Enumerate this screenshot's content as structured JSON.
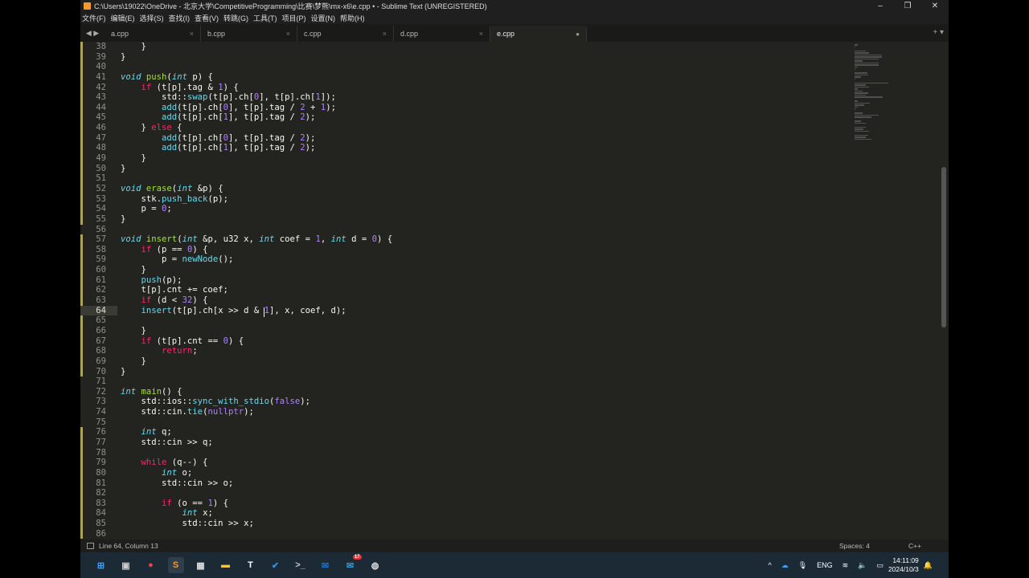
{
  "window": {
    "title": "C:\\Users\\19022\\OneDrive - 北京大学\\CompetitiveProgramming\\比赛\\梦熊\\mx-x6\\e.cpp • - Sublime Text (UNREGISTERED)",
    "minimize": "–",
    "maximize": "❐",
    "close": "✕"
  },
  "menu": [
    "文件(F)",
    "编辑(E)",
    "选择(S)",
    "查找(I)",
    "查看(V)",
    "转跳(G)",
    "工具(T)",
    "项目(P)",
    "设置(N)",
    "帮助(H)"
  ],
  "tabs": [
    {
      "name": "a.cpp",
      "active": false
    },
    {
      "name": "b.cpp",
      "active": false
    },
    {
      "name": "c.cpp",
      "active": false
    },
    {
      "name": "d.cpp",
      "active": false
    },
    {
      "name": "e.cpp",
      "active": true,
      "dirty": true
    }
  ],
  "tab_nav": "◀ ▶",
  "tab_actions": "+ ▾",
  "current_line": 64,
  "modified_lines": [
    38,
    39,
    40,
    41,
    42,
    43,
    44,
    45,
    46,
    47,
    48,
    49,
    50,
    51,
    52,
    53,
    54,
    55,
    57,
    58,
    59,
    60,
    61,
    62,
    63,
    64,
    65,
    66,
    67,
    68,
    69,
    70,
    76,
    77,
    78,
    79,
    80,
    81,
    82,
    83,
    84,
    85,
    86
  ],
  "code": [
    [
      38,
      [
        [
          "p",
          "    }"
        ]
      ]
    ],
    [
      39,
      [
        [
          "p",
          "}"
        ]
      ]
    ],
    [
      40,
      []
    ],
    [
      41,
      [
        [
          "k",
          "void"
        ],
        [
          "p",
          " "
        ],
        [
          "f",
          "push"
        ],
        [
          "p",
          "("
        ],
        [
          "k",
          "int"
        ],
        [
          "p",
          " p) {"
        ]
      ]
    ],
    [
      42,
      [
        [
          "p",
          "    "
        ],
        [
          "c",
          "if"
        ],
        [
          "p",
          " (t[p].tag & "
        ],
        [
          "n",
          "1"
        ],
        [
          "p",
          ") {"
        ]
      ]
    ],
    [
      43,
      [
        [
          "p",
          "        std::"
        ],
        [
          "s",
          "swap"
        ],
        [
          "p",
          "(t[p].ch["
        ],
        [
          "n",
          "0"
        ],
        [
          "p",
          "], t[p].ch["
        ],
        [
          "n",
          "1"
        ],
        [
          "p",
          "]);"
        ]
      ]
    ],
    [
      44,
      [
        [
          "p",
          "        "
        ],
        [
          "s",
          "add"
        ],
        [
          "p",
          "(t[p].ch["
        ],
        [
          "n",
          "0"
        ],
        [
          "p",
          "], t[p].tag / "
        ],
        [
          "n",
          "2"
        ],
        [
          "p",
          " + "
        ],
        [
          "n",
          "1"
        ],
        [
          "p",
          ");"
        ]
      ]
    ],
    [
      45,
      [
        [
          "p",
          "        "
        ],
        [
          "s",
          "add"
        ],
        [
          "p",
          "(t[p].ch["
        ],
        [
          "n",
          "1"
        ],
        [
          "p",
          "], t[p].tag / "
        ],
        [
          "n",
          "2"
        ],
        [
          "p",
          ");"
        ]
      ]
    ],
    [
      46,
      [
        [
          "p",
          "    } "
        ],
        [
          "c",
          "else"
        ],
        [
          "p",
          " {"
        ]
      ]
    ],
    [
      47,
      [
        [
          "p",
          "        "
        ],
        [
          "s",
          "add"
        ],
        [
          "p",
          "(t[p].ch["
        ],
        [
          "n",
          "0"
        ],
        [
          "p",
          "], t[p].tag / "
        ],
        [
          "n",
          "2"
        ],
        [
          "p",
          ");"
        ]
      ]
    ],
    [
      48,
      [
        [
          "p",
          "        "
        ],
        [
          "s",
          "add"
        ],
        [
          "p",
          "(t[p].ch["
        ],
        [
          "n",
          "1"
        ],
        [
          "p",
          "], t[p].tag / "
        ],
        [
          "n",
          "2"
        ],
        [
          "p",
          ");"
        ]
      ]
    ],
    [
      49,
      [
        [
          "p",
          "    }"
        ]
      ]
    ],
    [
      50,
      [
        [
          "p",
          "}"
        ]
      ]
    ],
    [
      51,
      []
    ],
    [
      52,
      [
        [
          "k",
          "void"
        ],
        [
          "p",
          " "
        ],
        [
          "f",
          "erase"
        ],
        [
          "p",
          "("
        ],
        [
          "k",
          "int"
        ],
        [
          "p",
          " &p) {"
        ]
      ]
    ],
    [
      53,
      [
        [
          "p",
          "    stk."
        ],
        [
          "s",
          "push_back"
        ],
        [
          "p",
          "(p);"
        ]
      ]
    ],
    [
      54,
      [
        [
          "p",
          "    p = "
        ],
        [
          "n",
          "0"
        ],
        [
          "p",
          ";"
        ]
      ]
    ],
    [
      55,
      [
        [
          "p",
          "}"
        ]
      ]
    ],
    [
      56,
      []
    ],
    [
      57,
      [
        [
          "k",
          "void"
        ],
        [
          "p",
          " "
        ],
        [
          "f",
          "insert"
        ],
        [
          "p",
          "("
        ],
        [
          "k",
          "int"
        ],
        [
          "p",
          " &p, u32 x, "
        ],
        [
          "k",
          "int"
        ],
        [
          "p",
          " coef = "
        ],
        [
          "n",
          "1"
        ],
        [
          "p",
          ", "
        ],
        [
          "k",
          "int"
        ],
        [
          "p",
          " d = "
        ],
        [
          "n",
          "0"
        ],
        [
          "p",
          ") {"
        ]
      ]
    ],
    [
      58,
      [
        [
          "p",
          "    "
        ],
        [
          "c",
          "if"
        ],
        [
          "p",
          " (p == "
        ],
        [
          "n",
          "0"
        ],
        [
          "p",
          ") {"
        ]
      ]
    ],
    [
      59,
      [
        [
          "p",
          "        p = "
        ],
        [
          "s",
          "newNode"
        ],
        [
          "p",
          "();"
        ]
      ]
    ],
    [
      60,
      [
        [
          "p",
          "    }"
        ]
      ]
    ],
    [
      61,
      [
        [
          "p",
          "    "
        ],
        [
          "s",
          "push"
        ],
        [
          "p",
          "(p);"
        ]
      ]
    ],
    [
      62,
      [
        [
          "p",
          "    t[p].cnt += coef;"
        ]
      ]
    ],
    [
      63,
      [
        [
          "p",
          "    "
        ],
        [
          "c",
          "if"
        ],
        [
          "p",
          " (d < "
        ],
        [
          "n",
          "32"
        ],
        [
          "p",
          ") {"
        ]
      ]
    ],
    [
      64,
      [
        [
          "p",
          "    "
        ],
        [
          "s",
          "insert"
        ],
        [
          "p",
          "(t[p].ch[x >> d & "
        ],
        [
          "n",
          "1"
        ],
        [
          "p",
          "], x, coef, d);"
        ]
      ]
    ],
    [
      65,
      []
    ],
    [
      66,
      [
        [
          "p",
          "    }"
        ]
      ]
    ],
    [
      67,
      [
        [
          "p",
          "    "
        ],
        [
          "c",
          "if"
        ],
        [
          "p",
          " (t[p].cnt == "
        ],
        [
          "n",
          "0"
        ],
        [
          "p",
          ") {"
        ]
      ]
    ],
    [
      68,
      [
        [
          "p",
          "        "
        ],
        [
          "c",
          "return"
        ],
        [
          "p",
          ";"
        ]
      ]
    ],
    [
      69,
      [
        [
          "p",
          "    }"
        ]
      ]
    ],
    [
      70,
      [
        [
          "p",
          "}"
        ]
      ]
    ],
    [
      71,
      []
    ],
    [
      72,
      [
        [
          "k",
          "int"
        ],
        [
          "p",
          " "
        ],
        [
          "f",
          "main"
        ],
        [
          "p",
          "() {"
        ]
      ]
    ],
    [
      73,
      [
        [
          "p",
          "    std::ios::"
        ],
        [
          "s",
          "sync_with_stdio"
        ],
        [
          "p",
          "("
        ],
        [
          "n",
          "false"
        ],
        [
          "p",
          ");"
        ]
      ]
    ],
    [
      74,
      [
        [
          "p",
          "    std::cin."
        ],
        [
          "s",
          "tie"
        ],
        [
          "p",
          "("
        ],
        [
          "n",
          "nullptr"
        ],
        [
          "p",
          ");"
        ]
      ]
    ],
    [
      75,
      []
    ],
    [
      76,
      [
        [
          "p",
          "    "
        ],
        [
          "k",
          "int"
        ],
        [
          "p",
          " q;"
        ]
      ]
    ],
    [
      77,
      [
        [
          "p",
          "    std::cin >> q;"
        ]
      ]
    ],
    [
      78,
      []
    ],
    [
      79,
      [
        [
          "p",
          "    "
        ],
        [
          "c",
          "while"
        ],
        [
          "p",
          " (q--) {"
        ]
      ]
    ],
    [
      80,
      [
        [
          "p",
          "        "
        ],
        [
          "k",
          "int"
        ],
        [
          "p",
          " o;"
        ]
      ]
    ],
    [
      81,
      [
        [
          "p",
          "        std::cin >> o;"
        ]
      ]
    ],
    [
      82,
      []
    ],
    [
      83,
      [
        [
          "p",
          "        "
        ],
        [
          "c",
          "if"
        ],
        [
          "p",
          " (o == "
        ],
        [
          "n",
          "1"
        ],
        [
          "p",
          ") {"
        ]
      ]
    ],
    [
      84,
      [
        [
          "p",
          "            "
        ],
        [
          "k",
          "int"
        ],
        [
          "p",
          " x;"
        ]
      ]
    ],
    [
      85,
      [
        [
          "p",
          "            std::cin >> x;"
        ]
      ]
    ],
    [
      86,
      []
    ]
  ],
  "status": {
    "position": "Line 64, Column 13",
    "indent": "Spaces: 4",
    "syntax": "C++"
  },
  "taskbar": {
    "apps": [
      {
        "icon": "windows-start-icon",
        "glyph": "⊞",
        "color": "#3aa0ff"
      },
      {
        "icon": "task-view-icon",
        "glyph": "▣",
        "color": "#ccc"
      },
      {
        "icon": "chrome-icon",
        "glyph": "●",
        "color": "#e8453c"
      },
      {
        "icon": "sublime-text-icon",
        "glyph": "S",
        "color": "#f29a2e",
        "active": true
      },
      {
        "icon": "calculator-icon",
        "glyph": "▦",
        "color": "#ddd"
      },
      {
        "icon": "file-explorer-icon",
        "glyph": "▬",
        "color": "#f5c542"
      },
      {
        "icon": "typora-icon",
        "glyph": "T",
        "color": "#fff"
      },
      {
        "icon": "todo-icon",
        "glyph": "✔",
        "color": "#3a8ee6"
      },
      {
        "icon": "terminal-icon",
        "glyph": ">_",
        "color": "#ccc"
      },
      {
        "icon": "outlook-icon",
        "glyph": "✉",
        "color": "#1a73c8"
      },
      {
        "icon": "messaging-icon",
        "glyph": "✉",
        "color": "#2d9cdb",
        "badge": "17"
      },
      {
        "icon": "app-icon",
        "glyph": "◍",
        "color": "#ddd"
      }
    ],
    "tray": {
      "chevron": "^",
      "language": "ENG",
      "time": "14:11:09",
      "date": "2024/10/3"
    }
  }
}
